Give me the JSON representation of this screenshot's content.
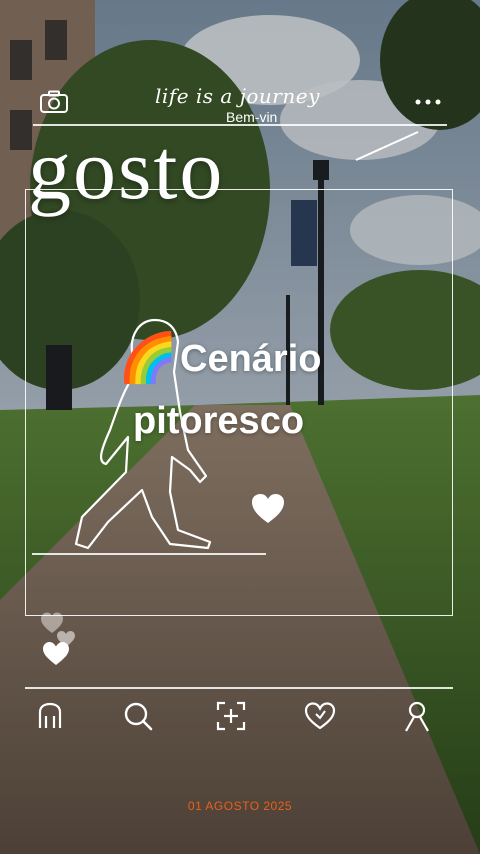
{
  "header": {
    "camera_icon": "camera-icon",
    "more_icon": "more-dots-icon",
    "tagline": "life is a journey",
    "welcome": "Bem-vin"
  },
  "hero": {
    "month": "gosto",
    "title_line1": "Cenário",
    "title_line2": "pitoresco",
    "rainbow_emoji": "🌈"
  },
  "nav": {
    "items": [
      {
        "icon": "home-icon"
      },
      {
        "icon": "search-icon"
      },
      {
        "icon": "add-icon"
      },
      {
        "icon": "heart-icon"
      },
      {
        "icon": "profile-icon"
      }
    ]
  },
  "footer": {
    "date": "01 AGOSTO 2025"
  },
  "colors": {
    "date": "#e8611a",
    "sky": "#9fb4c8",
    "grass": "#4f7a34",
    "path": "#8a7562"
  }
}
